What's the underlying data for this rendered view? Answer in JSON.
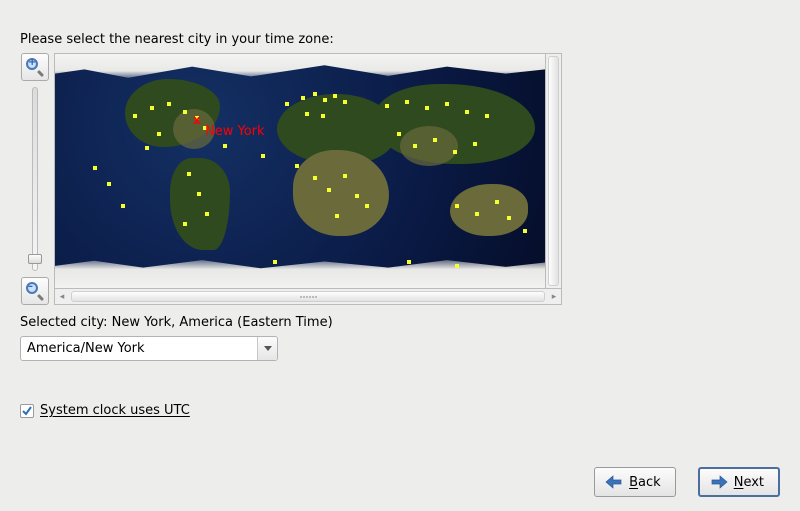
{
  "prompt": "Please select the nearest city in your time zone:",
  "selected_prefix": "Selected city: ",
  "selected_city_display": "New York, America (Eastern Time)",
  "timezone_combo_value": "America/New York",
  "utc_checkbox_label": "System clock uses UTC",
  "utc_checkbox_checked": true,
  "map_marker": {
    "label": "New York"
  },
  "buttons": {
    "back": {
      "mnemonic": "B",
      "rest": "ack"
    },
    "next": {
      "mnemonic": "N",
      "rest": "ext"
    }
  },
  "icons": {
    "zoom_in": "zoom-in-icon",
    "zoom_out": "zoom-out-icon",
    "back_arrow": "arrow-left-icon",
    "next_arrow": "arrow-right-icon",
    "chevron_down": "chevron-down-icon"
  }
}
